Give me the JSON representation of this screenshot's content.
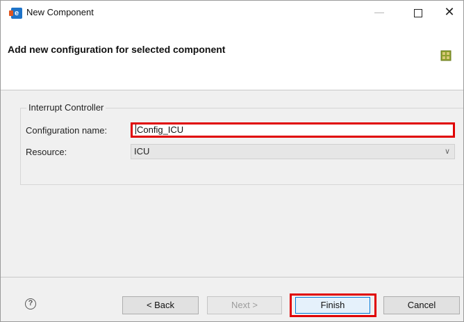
{
  "window": {
    "title": "New Component",
    "minimize_glyph": "—",
    "close_glyph": "✕"
  },
  "header": {
    "title": "Add new configuration for selected component"
  },
  "form": {
    "group_label": "Interrupt Controller",
    "configuration_name_label": "Configuration name:",
    "configuration_name_value": "Config_ICU",
    "resource_label": "Resource:",
    "resource_value": "ICU"
  },
  "footer": {
    "help_glyph": "?",
    "back_label": "< Back",
    "next_label": "Next >",
    "finish_label": "Finish",
    "cancel_label": "Cancel"
  },
  "colors": {
    "highlight": "#e00000",
    "default_button_border": "#0078d7"
  }
}
